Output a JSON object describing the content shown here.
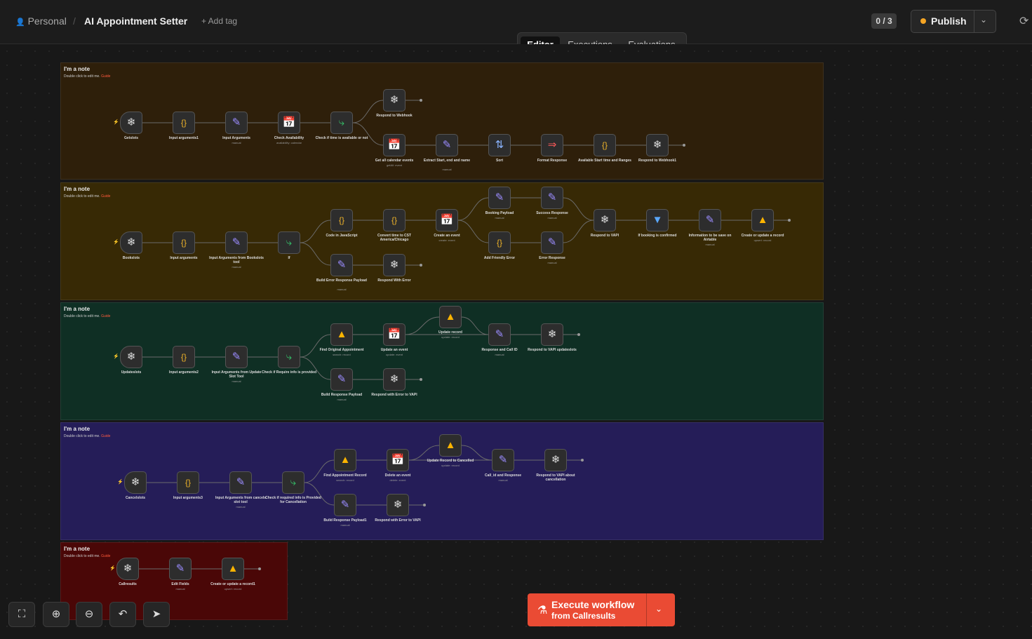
{
  "header": {
    "workspace": "Personal",
    "workflow_title": "AI Appointment Setter",
    "add_tag": "+ Add tag",
    "counter": "0 / 3",
    "publish_label": "Publish"
  },
  "tabs": [
    "Editor",
    "Executions",
    "Evaluations"
  ],
  "notes": [
    {
      "title": "I'm a note",
      "hint": "Double click to edit me.",
      "guide": "Guide",
      "color": "#2e1f0a"
    },
    {
      "title": "I'm a note",
      "hint": "Double click to edit me.",
      "guide": "Guide",
      "color": "#372905"
    },
    {
      "title": "I'm a note",
      "hint": "Double click to edit me.",
      "guide": "Guide",
      "color": "#0f2f24"
    },
    {
      "title": "I'm a note",
      "hint": "Double click to edit me.",
      "guide": "Guide",
      "color": "#251d58"
    },
    {
      "title": "I'm a note",
      "hint": "Double click to edit me.",
      "guide": "Guide",
      "color": "#4a0707"
    }
  ],
  "nodes": [
    {
      "id": "getslots",
      "label": "Getslots",
      "sub": "",
      "icon": "webhook-icon"
    },
    {
      "id": "ia1",
      "label": "Input arguments1",
      "sub": "",
      "icon": "code-icon"
    },
    {
      "id": "inargs",
      "label": "Input Arguments",
      "sub": "manual",
      "icon": "edit-icon"
    },
    {
      "id": "checkavail",
      "label": "Check Availability",
      "sub": "availability: calendar",
      "icon": "calendar-icon"
    },
    {
      "id": "checktime",
      "label": "Check if time is available or not",
      "sub": "",
      "icon": "if-icon"
    },
    {
      "id": "rtw",
      "label": "Respond to Webhook",
      "sub": "",
      "icon": "webhook-icon"
    },
    {
      "id": "getall",
      "label": "Get all calendar events",
      "sub": "getAll: event",
      "icon": "calendar-icon"
    },
    {
      "id": "extract",
      "label": "Extract Start, end and name",
      "sub": "manual",
      "icon": "edit-icon"
    },
    {
      "id": "sort",
      "label": "Sort",
      "sub": "",
      "icon": "sort-icon"
    },
    {
      "id": "format",
      "label": "Format Response",
      "sub": "",
      "icon": "format-icon"
    },
    {
      "id": "avail",
      "label": "Available Start time and Ranges",
      "sub": "",
      "icon": "code-icon"
    },
    {
      "id": "rtw1",
      "label": "Respond to Webhook1",
      "sub": "",
      "icon": "webhook-icon"
    },
    {
      "id": "bookslots",
      "label": "Bookslots",
      "sub": "",
      "icon": "webhook-icon"
    },
    {
      "id": "ia",
      "label": "Input arguments",
      "sub": "",
      "icon": "code-icon"
    },
    {
      "id": "iabook",
      "label": "Input Arguments from Bookslots tool",
      "sub": "manual",
      "icon": "edit-icon"
    },
    {
      "id": "if",
      "label": "If",
      "sub": "",
      "icon": "if-icon"
    },
    {
      "id": "codejs",
      "label": "Code in JavaScript",
      "sub": "",
      "icon": "code-icon"
    },
    {
      "id": "convert",
      "label": "Convert time to CST America/Chicago",
      "sub": "",
      "icon": "code-icon"
    },
    {
      "id": "create",
      "label": "Create an event",
      "sub": "create: event",
      "icon": "calendar-icon"
    },
    {
      "id": "bookpay",
      "label": "Booking Payload",
      "sub": "manual",
      "icon": "edit-icon"
    },
    {
      "id": "success",
      "label": "Success Response",
      "sub": "manual",
      "icon": "edit-icon"
    },
    {
      "id": "friendly",
      "label": "Add Friendly Error",
      "sub": "",
      "icon": "code-icon"
    },
    {
      "id": "errresp",
      "label": "Error Response",
      "sub": "manual",
      "icon": "edit-icon"
    },
    {
      "id": "rvapi",
      "label": "Respond to VAPI",
      "sub": "",
      "icon": "webhook-icon"
    },
    {
      "id": "ifbook",
      "label": "If booking is confirmed",
      "sub": "",
      "icon": "filter-icon"
    },
    {
      "id": "infoair",
      "label": "Information to be save on Airtable",
      "sub": "manual",
      "icon": "edit-icon"
    },
    {
      "id": "cupd",
      "label": "Create or update a record",
      "sub": "upsert: record",
      "icon": "airtable-icon"
    },
    {
      "id": "builderr",
      "label": "Build Error Response Payload",
      "sub": "manual",
      "icon": "edit-icon"
    },
    {
      "id": "resperr",
      "label": "Respond With Error",
      "sub": "",
      "icon": "webhook-icon"
    },
    {
      "id": "updateslots",
      "label": "Updateslots",
      "sub": "",
      "icon": "webhook-icon"
    },
    {
      "id": "ia2",
      "label": "Input arguments2",
      "sub": "",
      "icon": "code-icon"
    },
    {
      "id": "iaupd",
      "label": "Input Arguments from Update Slot Tool",
      "sub": "manual",
      "icon": "edit-icon"
    },
    {
      "id": "checkreq",
      "label": "Check if Require info is provided",
      "sub": "",
      "icon": "if-icon"
    },
    {
      "id": "findorig",
      "label": "Find Original Appointment",
      "sub": "search: record",
      "icon": "airtable-icon"
    },
    {
      "id": "updevent",
      "label": "Update an event",
      "sub": "update: event",
      "icon": "calendar-icon"
    },
    {
      "id": "updrec",
      "label": "Update record",
      "sub": "update: record",
      "icon": "airtable-icon"
    },
    {
      "id": "respcall",
      "label": "Response and Call ID",
      "sub": "manual",
      "icon": "edit-icon"
    },
    {
      "id": "rvapiupd",
      "label": "Respond to VAPI updateslots",
      "sub": "",
      "icon": "webhook-icon"
    },
    {
      "id": "buildresp",
      "label": "Build Response Payload",
      "sub": "manual",
      "icon": "edit-icon"
    },
    {
      "id": "resperrvapi",
      "label": "Respond with Error to VAPI",
      "sub": "",
      "icon": "webhook-icon"
    },
    {
      "id": "cancelslots",
      "label": "Cancelslots",
      "sub": "",
      "icon": "webhook-icon"
    },
    {
      "id": "ia3",
      "label": "Input arguments3",
      "sub": "",
      "icon": "code-icon"
    },
    {
      "id": "iacancel",
      "label": "Input Arguments from cancels slot tool",
      "sub": "manual",
      "icon": "edit-icon"
    },
    {
      "id": "checkcancel",
      "label": "Check if required info is Provided for Cancellation",
      "sub": "",
      "icon": "if-icon"
    },
    {
      "id": "findappt",
      "label": "Find Appointment Record",
      "sub": "search: record",
      "icon": "airtable-icon"
    },
    {
      "id": "delevent",
      "label": "Delete an event",
      "sub": "delete: event",
      "icon": "calendar-icon"
    },
    {
      "id": "updcancel",
      "label": "Update Record to Cancelled",
      "sub": "update: record",
      "icon": "airtable-icon"
    },
    {
      "id": "callid",
      "label": "Call_id and Response",
      "sub": "manual",
      "icon": "edit-icon"
    },
    {
      "id": "rvapicancel",
      "label": "Respond to VAPI about cancellation",
      "sub": "",
      "icon": "webhook-icon"
    },
    {
      "id": "buildresp1",
      "label": "Build Response Payload1",
      "sub": "manual",
      "icon": "edit-icon"
    },
    {
      "id": "resperrvapi2",
      "label": "Respond with Error to VAPI",
      "sub": "",
      "icon": "webhook-icon"
    },
    {
      "id": "callresults",
      "label": "Callresults",
      "sub": "",
      "icon": "webhook-icon"
    },
    {
      "id": "editfields",
      "label": "Edit Fields",
      "sub": "manual",
      "icon": "edit-icon"
    },
    {
      "id": "cupd1",
      "label": "Create or update a record1",
      "sub": "upsert: record",
      "icon": "airtable-icon"
    }
  ],
  "controls": [
    {
      "name": "fit-view",
      "icon": "expand-icon"
    },
    {
      "name": "zoom-in",
      "icon": "zoom-in-icon"
    },
    {
      "name": "zoom-out",
      "icon": "zoom-out-icon"
    },
    {
      "name": "undo",
      "icon": "undo-icon"
    },
    {
      "name": "tidy-up",
      "icon": "broom-icon"
    }
  ],
  "execute": {
    "line1": "Execute workflow",
    "line2": "from Callresults"
  },
  "colors": {
    "accent": "#ea4b34",
    "publish_dot": "#f5a524"
  }
}
